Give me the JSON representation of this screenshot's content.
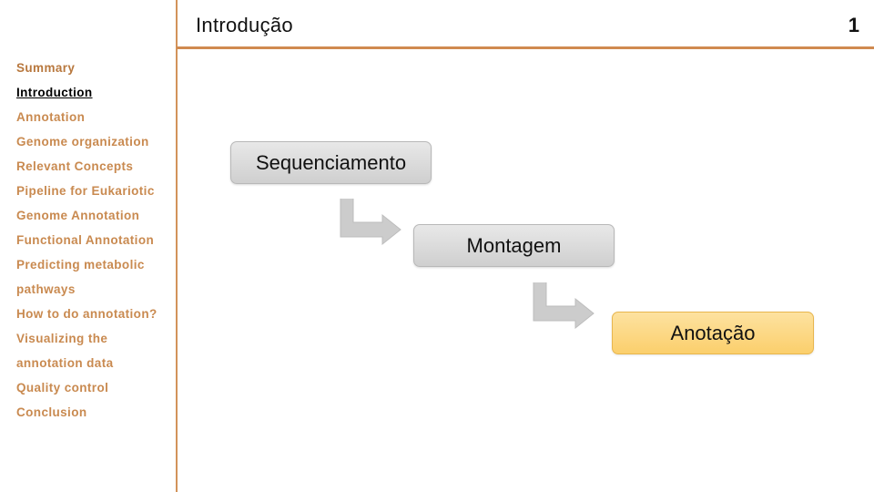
{
  "header": {
    "title": "Introdução",
    "slide_number": "1"
  },
  "sidebar": {
    "items": [
      {
        "label": "Summary",
        "active": false
      },
      {
        "label": "Introduction",
        "active": true
      },
      {
        "label": "Annotation",
        "active": false
      },
      {
        "label": "Genome organization",
        "active": false
      },
      {
        "label": "Relevant Concepts",
        "active": false
      },
      {
        "label": "Pipeline for Eukariotic",
        "active": false
      },
      {
        "label": "Genome Annotation",
        "active": false
      },
      {
        "label": "Functional Annotation",
        "active": false
      },
      {
        "label": "Predicting metabolic",
        "active": false
      },
      {
        "label": "pathways",
        "active": false
      },
      {
        "label": "How to do annotation?",
        "active": false
      },
      {
        "label": "Visualizing the",
        "active": false
      },
      {
        "label": "annotation data",
        "active": false
      },
      {
        "label": "Quality control",
        "active": false
      },
      {
        "label": "Conclusion",
        "active": false
      }
    ]
  },
  "diagram": {
    "steps": [
      {
        "label": "Sequenciamento",
        "style": "grey"
      },
      {
        "label": "Montagem",
        "style": "grey"
      },
      {
        "label": "Anotação",
        "style": "highlight"
      }
    ],
    "connectors": [
      {
        "icon": "bent-arrow-icon"
      },
      {
        "icon": "bent-arrow-icon"
      }
    ]
  },
  "colors": {
    "accent": "#d08a50",
    "sidebar_text": "#c98a50",
    "active_text": "#000000",
    "step_grey": "#d8d8d8",
    "step_highlight": "#fcd67e",
    "arrow_fill": "#cccccc"
  }
}
